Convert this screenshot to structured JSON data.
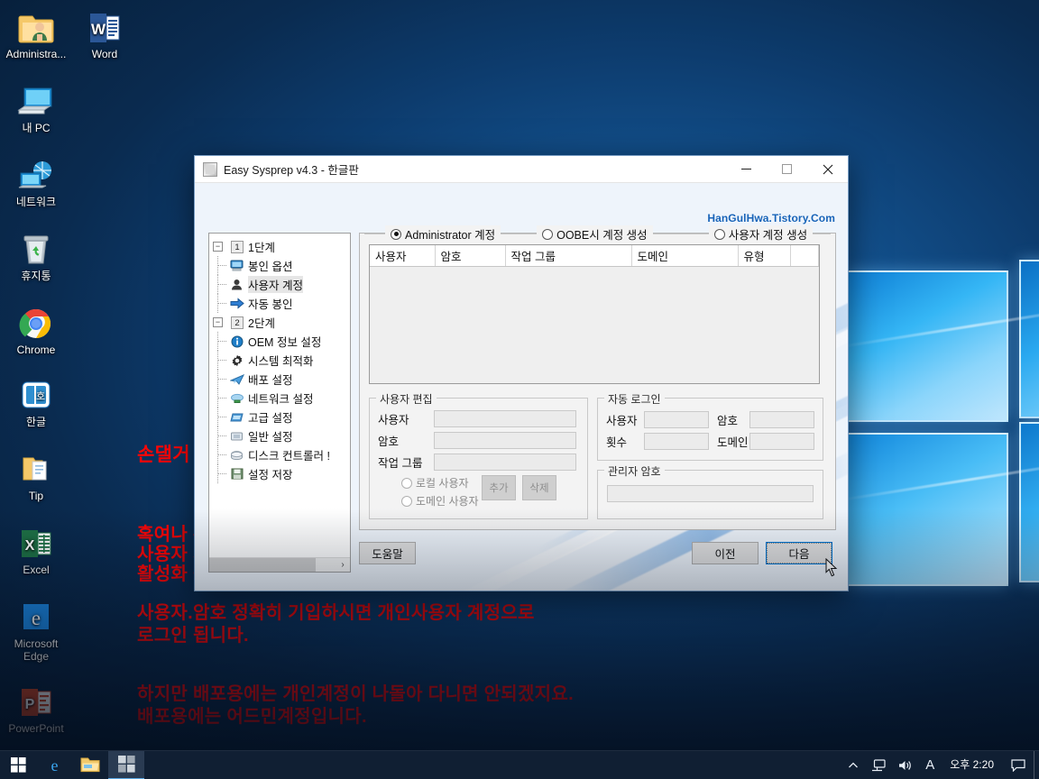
{
  "desktop": {
    "icons": [
      {
        "label": "Administra...",
        "icon": "folder-user-icon"
      },
      {
        "label": "Word",
        "icon": "word-icon"
      },
      {
        "label": "내 PC",
        "icon": "this-pc-icon"
      },
      {
        "label": "네트워크",
        "icon": "network-icon"
      },
      {
        "label": "휴지통",
        "icon": "recycle-bin-icon"
      },
      {
        "label": "Chrome",
        "icon": "chrome-icon"
      },
      {
        "label": "한글",
        "icon": "hangul-icon"
      },
      {
        "label": "Tip",
        "icon": "folder-tip-icon"
      },
      {
        "label": "Excel",
        "icon": "excel-icon"
      },
      {
        "label": "Microsoft Edge",
        "icon": "edge-icon"
      },
      {
        "label": "PowerPoint",
        "icon": "powerpoint-icon"
      }
    ]
  },
  "taskbar": {
    "start": "start-icon",
    "items": [
      {
        "name": "edge-icon",
        "label": "Microsoft Edge"
      },
      {
        "name": "file-explorer-icon",
        "label": "파일 탐색기"
      },
      {
        "name": "easy-sysprep-taskbar-icon",
        "label": "Easy Sysprep v4.3",
        "active": true
      }
    ],
    "tray": [
      {
        "name": "show-hidden-icons",
        "glyph": "︿"
      },
      {
        "name": "network-tray-icon",
        "glyph": "🖳"
      },
      {
        "name": "volume-tray-icon",
        "glyph": "🔊"
      },
      {
        "name": "ime-tray-icon",
        "glyph": "A"
      }
    ],
    "clock": "오후 2:20",
    "action_center": "action-center-icon"
  },
  "window": {
    "title": "Easy Sysprep v4.3 - 한글판",
    "watermark": "HanGulHwa.Tistory.Com",
    "controls": {
      "minimize": "−",
      "maximize": "▢",
      "close": "✕"
    }
  },
  "tree": {
    "stage1": {
      "num": "1",
      "label": "1단계",
      "expander": "−"
    },
    "stage1_children": [
      {
        "label": "봉인 옵션",
        "icon": "monitor-icon",
        "selected": false
      },
      {
        "label": "사용자 계정",
        "icon": "user-icon",
        "selected": true
      },
      {
        "label": "자동 봉인",
        "icon": "blue-arrow-icon",
        "selected": false
      }
    ],
    "stage2": {
      "num": "2",
      "label": "2단계",
      "expander": "−"
    },
    "stage2_children": [
      {
        "label": "OEM 정보 설정",
        "icon": "info-icon",
        "selected": false
      },
      {
        "label": "시스템 최적화",
        "icon": "gear-icon",
        "selected": false
      },
      {
        "label": "배포 설정",
        "icon": "deploy-icon",
        "selected": false
      },
      {
        "label": "네트워크 설정",
        "icon": "network-cloud-icon",
        "selected": false
      },
      {
        "label": "고급 설정",
        "icon": "advanced-icon",
        "selected": false
      },
      {
        "label": "일반 설정",
        "icon": "general-icon",
        "selected": false
      },
      {
        "label": "디스크 컨트롤러 !",
        "icon": "disk-icon",
        "selected": false
      },
      {
        "label": "설정 저장",
        "icon": "save-icon",
        "selected": false
      }
    ],
    "scroll_right_arrow": "›"
  },
  "content": {
    "account_modes": [
      {
        "label": "Administrator 계정",
        "selected": true
      },
      {
        "label": "OOBE시 계정 생성",
        "selected": false
      },
      {
        "label": "사용자 계정 생성",
        "selected": false
      }
    ],
    "grid": {
      "columns": [
        "사용자",
        "암호",
        "작업 그룹",
        "도메인",
        "유형",
        ""
      ],
      "rows": []
    },
    "user_edit": {
      "legend": "사용자 편집",
      "fields": [
        {
          "label": "사용자",
          "value": "",
          "placeholder": ""
        },
        {
          "label": "암호",
          "value": "",
          "placeholder": ""
        },
        {
          "label": "작업 그룹",
          "value": "",
          "placeholder": ""
        }
      ],
      "radios": [
        {
          "label": "로컬 사용자",
          "selected": false
        },
        {
          "label": "도메인 사용자",
          "selected": false
        }
      ],
      "buttons": [
        {
          "label": "추가",
          "name": "add-user-button"
        },
        {
          "label": "삭제",
          "name": "delete-user-button"
        }
      ]
    },
    "auto_login": {
      "legend": "자동 로그인",
      "fields": [
        {
          "label": "사용자",
          "value": ""
        },
        {
          "label": "암호",
          "value": ""
        },
        {
          "label": "횟수",
          "value": ""
        },
        {
          "label": "도메인",
          "value": ""
        }
      ]
    },
    "admin_password": {
      "legend": "관리자 암호",
      "value": ""
    }
  },
  "footer": {
    "help": "도움말",
    "prev": "이전",
    "next": "다음"
  },
  "annotations": [
    "손댈거 없음.",
    "혹여나 본인계정을 넣고싶다 하시면\n사용자 계정 체크하시면 아래 사용자 편집창이\n활성화 됩니다.",
    "사용자.암호 정확히 기입하시면 개인사용자 계정으로\n로그인 됩니다.",
    "하지만 배포용에는 개인계정이 나돌아 다니면 안되겠지요.\n배포용에는 어드민계정입니다."
  ],
  "colors": {
    "annotation_red": "#fc0606",
    "watermark_blue": "#1763b8",
    "focus_blue": "#0078d7",
    "taskbar": "#101f33"
  }
}
